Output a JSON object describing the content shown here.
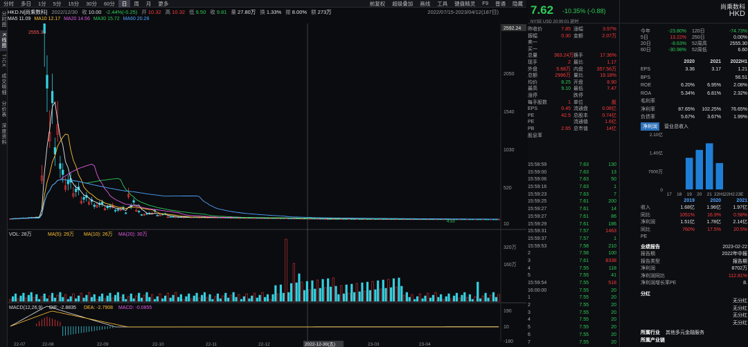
{
  "toolbar": {
    "left": [
      "分时",
      "多日",
      "1分",
      "5分",
      "15分",
      "30分",
      "60分",
      "日",
      "周",
      "月",
      "更多"
    ],
    "active": "日",
    "right": [
      "前复权",
      "超级叠加",
      "画线",
      "工具",
      "键盘精灵",
      "F9",
      "普通",
      "隐藏"
    ]
  },
  "infobar": {
    "code": "HKD.N[尚乘数科]",
    "date": "2022/12/30",
    "open_label": "收",
    "close": "10.00",
    "change": "-2.44%(-0.25)",
    "o_label": "开",
    "o": "10.32",
    "h_label": "高",
    "h": "10.32",
    "l_label": "低",
    "l": "9.50",
    "c_label": "收",
    "c": "9.81",
    "vol_label": "量",
    "vol": "27.80万",
    "turn_label": "换",
    "turn": "1.33%",
    "amp_label": "振",
    "amp": "8.00%",
    "amt_label": "额",
    "amt": "273万",
    "range": "2022/07/15-2023/04/12(187日)"
  },
  "ma": {
    "ma5": "MA5 11.09",
    "ma10": "MA10 12.17",
    "ma20": "MA20 14.56",
    "ma30": "MA30 15.72",
    "ma60": "MA60 20.28"
  },
  "lefttabs": [
    "分时图",
    "K线图",
    "TICK",
    "成交明细",
    "分价表",
    "深度资料"
  ],
  "left_active": "K线图",
  "vol_legend": {
    "vol": "VOL: 28万",
    "ma5": "MA(5): 29万",
    "ma10": "MA(10): 26万",
    "ma20": "MA(20): 30万"
  },
  "macd_legend": {
    "title": "MACD(12,26,9)",
    "dif": "DIF: -2.8835",
    "dea": "DEA: -2.7908",
    "macd": "MACD: -0.0855"
  },
  "price_axis": [
    "2592.24",
    "2050",
    "1540",
    "1030",
    "520",
    "10"
  ],
  "max_label": "2555.30",
  "min_label": "4.93",
  "vol_axis": [
    "320万",
    "160万"
  ],
  "macd_axis": [
    "190",
    "10",
    "-180"
  ],
  "xaxis": [
    "22-07",
    "22-08",
    "22-09",
    "22-10",
    "22-11",
    "22-12",
    "2022-12-30(五)",
    "23-03",
    "23-04"
  ],
  "chart_data": {
    "type": "candlestick",
    "ma_colors": {
      "ma5": "#e6e6e6",
      "ma10": "#ffc233",
      "ma20": "#e05ce0",
      "ma30": "#2ecc57",
      "ma60": "#4ea3ff"
    }
  },
  "quote": {
    "price": "7.62",
    "change": "-10.35% (-0.88)",
    "name": "尚乘数科",
    "code": "HKD",
    "exch": "NYSE",
    "currency": "USD",
    "time": "20:00:01",
    "status": "延时",
    "adr": "ADR"
  },
  "stats": [
    [
      "昨收价",
      "7.85",
      "涨幅",
      "3.97%"
    ],
    [
      "振幅",
      "0.30",
      "金额",
      "2.07万"
    ],
    [
      "卖一",
      "",
      "",
      " "
    ],
    [
      "买一",
      "",
      "",
      ""
    ],
    [
      "总量",
      "363.24万",
      "换手",
      "17.36%"
    ],
    [
      "现手",
      "2",
      "最比",
      "1.17"
    ],
    [
      "外盘",
      "5.68万",
      "内盘",
      "357.56万"
    ],
    [
      "总额",
      "2996万",
      "量比",
      "19.18%"
    ],
    [
      "均价",
      "8.25",
      "开盘",
      "8.90"
    ],
    [
      "最高",
      "9.10",
      "最低",
      "7.47"
    ],
    [
      "涨停",
      "",
      "跌停",
      ""
    ],
    [
      "每手股数",
      "1",
      "单位",
      "股"
    ],
    [
      "EPS",
      "0.45",
      "流通盘",
      "0.08亿"
    ],
    [
      "PE",
      "42.5",
      "总股本",
      "0.74亿"
    ],
    [
      "PE",
      "",
      "流通值",
      "1.6亿"
    ],
    [
      "PB",
      "2.65",
      "总市值",
      "14亿"
    ],
    [
      "股息率",
      "",
      "",
      ""
    ]
  ],
  "ticks": [
    [
      "15:58:59",
      "7.63",
      "130"
    ],
    [
      "15:59:00",
      "7.63",
      "13"
    ],
    [
      "15:59:06",
      "7.63",
      "50"
    ],
    [
      "15:59:16",
      "7.63",
      "1"
    ],
    [
      "15:59:23",
      "7.63",
      "7"
    ],
    [
      "15:59:25",
      "7.61",
      "200"
    ],
    [
      "15:59:27",
      "7.61",
      "14"
    ],
    [
      "15:59:27",
      "7.61",
      "86"
    ],
    [
      "15:59:29",
      "7.61",
      "186"
    ],
    [
      "15:59:31",
      "7.57",
      "1463"
    ],
    [
      "15:59:37",
      "7.57",
      "1"
    ],
    [
      "15:59:53",
      "7.58",
      "210"
    ],
    [
      "2",
      "7.58",
      "100"
    ],
    [
      "3",
      "7.61",
      "8338"
    ],
    [
      "4",
      "7.55",
      "118"
    ],
    [
      "5",
      "7.55",
      "41"
    ],
    [
      "15:59:54",
      "7.55",
      "518"
    ],
    [
      "16:00:00",
      "7.55",
      "20"
    ],
    [
      "1",
      "7.55",
      "20"
    ],
    [
      "2",
      "7.55",
      "20"
    ],
    [
      "3",
      "7.55",
      "20"
    ],
    [
      "4",
      "7.55",
      "20"
    ],
    [
      "5",
      "7.55",
      "20"
    ],
    [
      "6",
      "7.55",
      "20"
    ],
    [
      "7",
      "7.55",
      "20"
    ]
  ],
  "perf": [
    [
      "今年",
      "-23.80%",
      "120日",
      "-74.73%"
    ],
    [
      "5日",
      "13.22%",
      "250日",
      "0.00%"
    ],
    [
      "20日",
      "-8.63%",
      "52周高",
      "2555.30"
    ],
    [
      "60日",
      "-30.98%",
      "52周低",
      "6.60"
    ]
  ],
  "fin_head": [
    "2020",
    "2021",
    "2022H1"
  ],
  "fin": [
    [
      "EPS",
      "3.36",
      "3.17",
      "1.21"
    ],
    [
      "BPS",
      "",
      "",
      "56.51"
    ],
    [
      "ROE",
      "6.20%",
      "6.95%",
      "2.08%"
    ],
    [
      "ROA",
      "5.34%",
      "6.81%",
      "2.32%"
    ],
    [
      "毛利率",
      "",
      "",
      ""
    ],
    [
      "净利率",
      "87.65%",
      "102.25%",
      "76.65%"
    ],
    [
      "负债率",
      "5.67%",
      "3.67%",
      "1.99%"
    ]
  ],
  "fin_tabs": [
    "净利润",
    "营业总收入"
  ],
  "bar_axis": [
    "2.10亿",
    "1.40亿",
    "7000万",
    "0"
  ],
  "bar_x": [
    "17",
    "18",
    "19",
    "20",
    "21",
    "22H1",
    "22H2",
    "23E"
  ],
  "bar_vals": [
    0,
    0,
    1.2,
    1.5,
    1.75,
    1.0,
    0,
    0
  ],
  "annual_head": [
    "2019",
    "2020",
    "2021"
  ],
  "annual": [
    [
      "收入",
      "1.68亿",
      "1.96亿",
      "1.97亿"
    ],
    [
      "同比",
      "1051%",
      "16.9%",
      "0.58%"
    ],
    [
      "净利润",
      "1.51亿",
      "1.78亿",
      "2.14亿"
    ],
    [
      "同比",
      "760%",
      "17.5%",
      "20.5%"
    ],
    [
      "PE",
      "",
      "",
      ""
    ]
  ],
  "report": {
    "title": "业绩报告",
    "date": "2023-02-22",
    "l1": "报告期",
    "v1": "2022年中报",
    "l2": "报告类型",
    "v2": "报告期",
    "l3": "净利润",
    "v3": "8702万",
    "l4": "净利润同比",
    "v4": "112.81%",
    "l5": "净利润增长率PE",
    "v5": "8."
  },
  "dividend": {
    "title": "分红",
    "rows": [
      "无分红",
      "无分红",
      "无分红",
      "无分红"
    ]
  },
  "industry": {
    "l1": "所属行业",
    "v1": "其他多元金融服务",
    "l2": "所属产业链",
    "": ""
  }
}
